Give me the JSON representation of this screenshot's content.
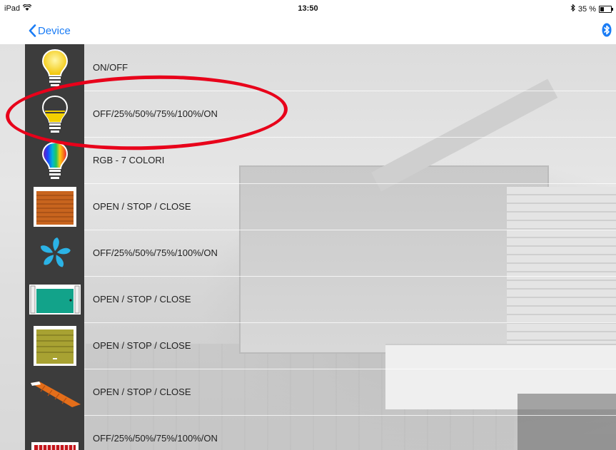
{
  "status_bar": {
    "device": "iPad",
    "wifi_icon": "wifi-icon",
    "time": "13:50",
    "bluetooth_icon": "bluetooth-icon",
    "battery": "35 %",
    "battery_icon": "battery-icon"
  },
  "nav": {
    "back_label": "Device",
    "back_icon": "chevron-left-icon",
    "right_icon": "bluetooth-icon",
    "accent": "#1a7cf5"
  },
  "devices": [
    {
      "label": "ON/OFF",
      "icon": "lightbulb-icon"
    },
    {
      "label": "OFF/25%/50%/75%/100%/ON",
      "icon": "dimmer-bulb-icon"
    },
    {
      "label": "RGB - 7 COLORI",
      "icon": "rgb-bulb-icon"
    },
    {
      "label": "OPEN / STOP / CLOSE",
      "icon": "roller-shutter-icon"
    },
    {
      "label": "OFF/25%/50%/75%/100%/ON",
      "icon": "fan-icon"
    },
    {
      "label": "OPEN / STOP / CLOSE",
      "icon": "sliding-gate-icon"
    },
    {
      "label": "OPEN / STOP / CLOSE",
      "icon": "garage-door-icon"
    },
    {
      "label": "OPEN / STOP / CLOSE",
      "icon": "barrier-icon"
    },
    {
      "label": "OFF/25%/50%/75%/100%/ON",
      "icon": "heater-icon"
    }
  ],
  "highlight_color": "#e8001a"
}
